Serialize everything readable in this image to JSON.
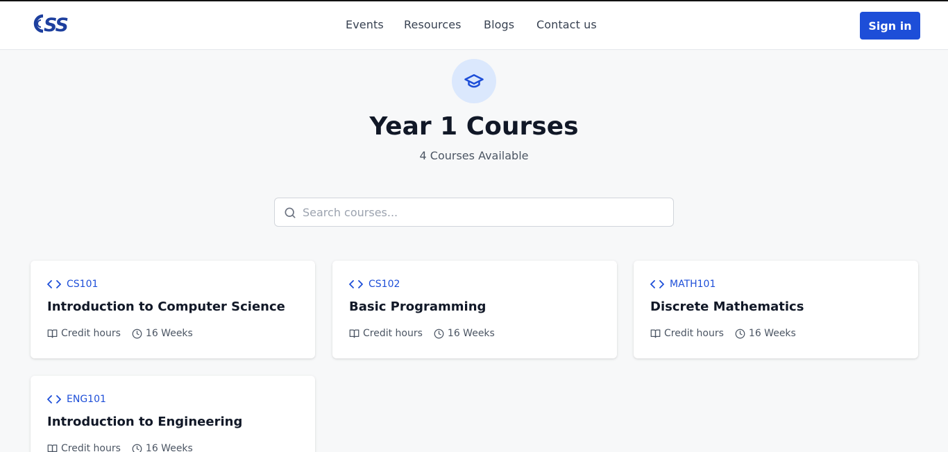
{
  "header": {
    "logo_text": "CSS",
    "nav": [
      "Events",
      "Resources",
      "Blogs",
      "Contact us"
    ],
    "signin_label": "Sign in"
  },
  "hero": {
    "icon": "graduation-cap-icon",
    "title": "Year 1 Courses",
    "subtitle": "4 Courses Available"
  },
  "search": {
    "placeholder": "Search courses...",
    "value": ""
  },
  "courses": [
    {
      "code": "CS101",
      "title": "Introduction to Computer Science",
      "credit_label": "Credit hours",
      "duration": "16 Weeks"
    },
    {
      "code": "CS102",
      "title": "Basic Programming",
      "credit_label": "Credit hours",
      "duration": "16 Weeks"
    },
    {
      "code": "MATH101",
      "title": "Discrete Mathematics",
      "credit_label": "Credit hours",
      "duration": "16 Weeks"
    },
    {
      "code": "ENG101",
      "title": "Introduction to Engineering",
      "credit_label": "Credit hours",
      "duration": "16 Weeks"
    }
  ],
  "colors": {
    "accent": "#1d4ed8",
    "hero_icon_bg": "#dbe8fd",
    "page_bg": "#f7f8f9"
  }
}
